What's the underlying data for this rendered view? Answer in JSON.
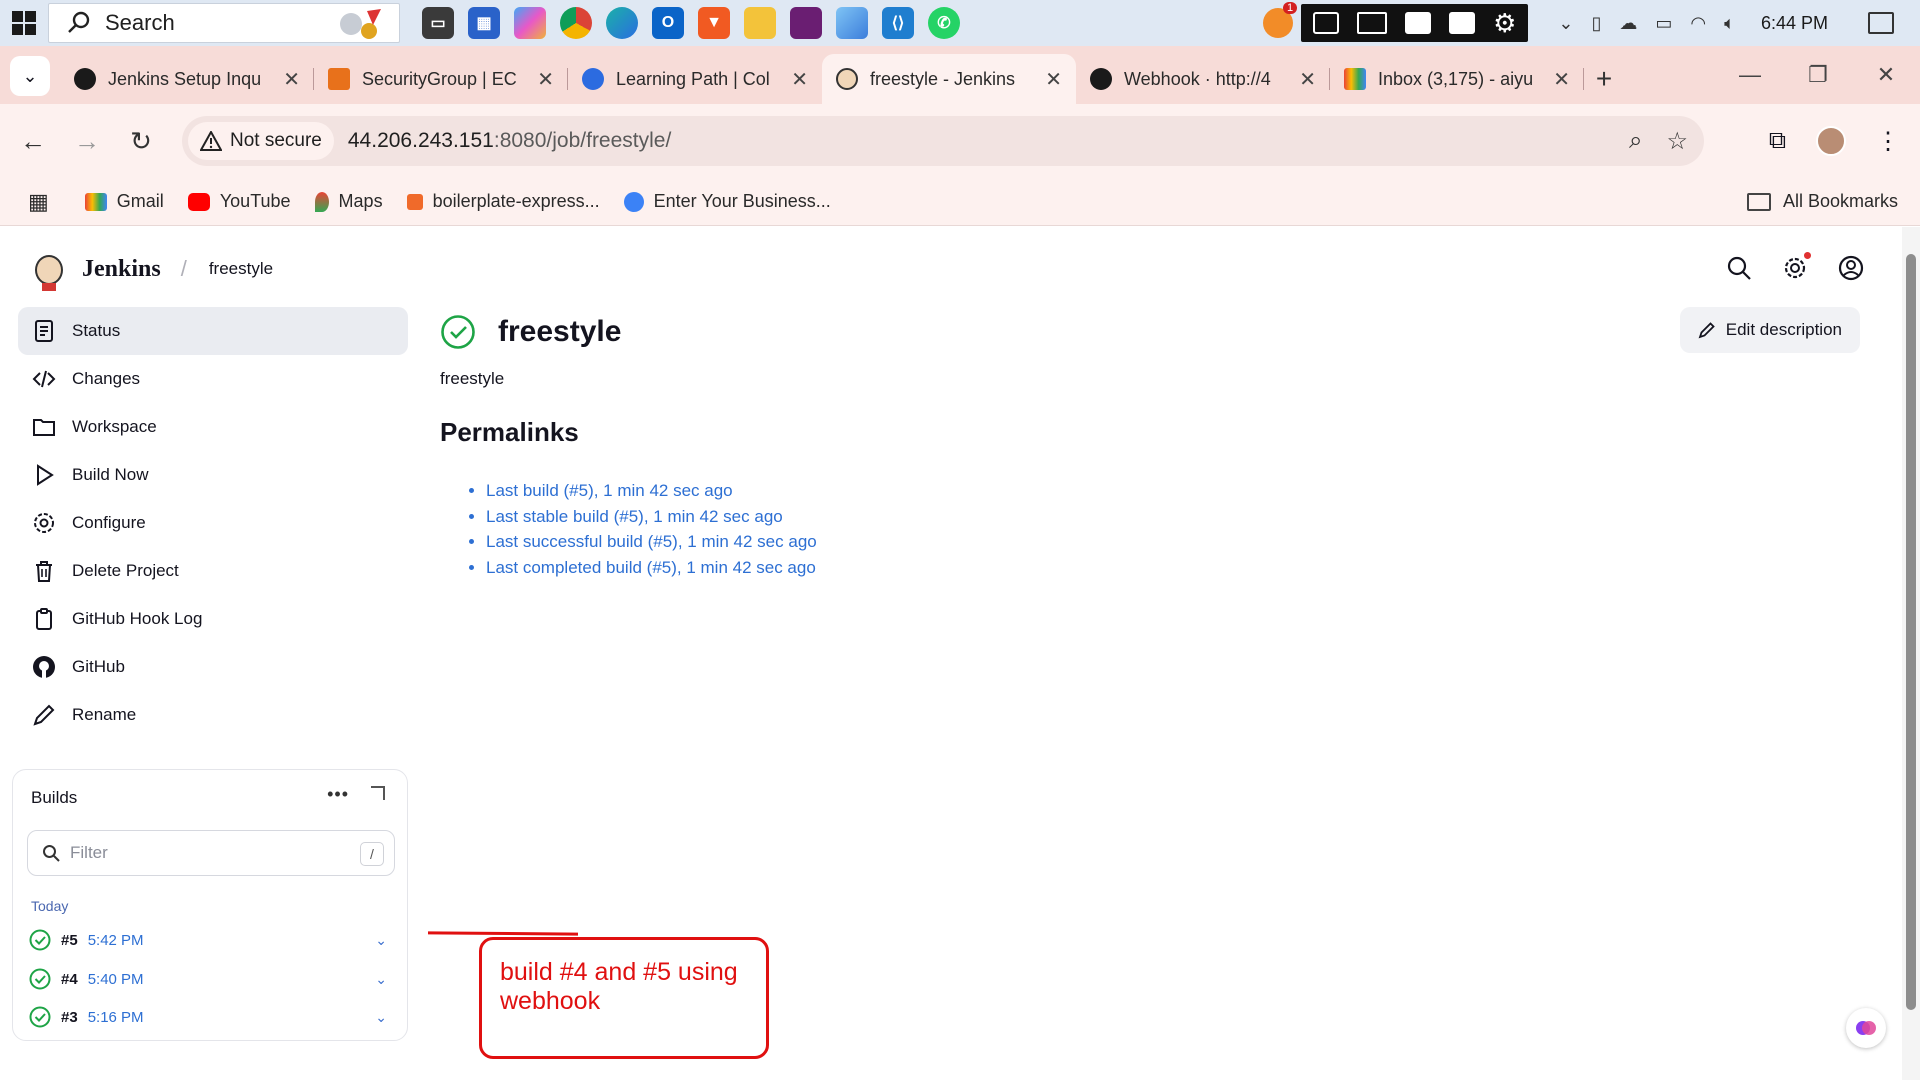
{
  "taskbar": {
    "search_placeholder": "Search",
    "apps": [
      "file-explorer",
      "microsoft-store",
      "copilot",
      "chrome",
      "edge",
      "outlook",
      "brave",
      "file-manager",
      "vscode-remote",
      "power-automate",
      "vscode",
      "whatsapp"
    ],
    "badge_count": "1",
    "clock": "6:44 PM"
  },
  "tabs": [
    {
      "title": "Jenkins Setup Inqu",
      "active": false
    },
    {
      "title": "SecurityGroup | EC",
      "active": false
    },
    {
      "title": "Learning Path | Col",
      "active": false
    },
    {
      "title": "freestyle - Jenkins",
      "active": true
    },
    {
      "title": "Webhook · http://4",
      "active": false
    },
    {
      "title": "Inbox (3,175) - aiyu",
      "active": false
    }
  ],
  "addressbar": {
    "security_label": "Not secure",
    "url_host": "44.206.243.151",
    "url_path": ":8080/job/freestyle/"
  },
  "bookmarks": {
    "items": [
      "Gmail",
      "YouTube",
      "Maps",
      "boilerplate-express...",
      "Enter Your Business..."
    ],
    "all_label": "All Bookmarks"
  },
  "jenkins": {
    "brand": "Jenkins",
    "breadcrumb": "freestyle",
    "sidebar": [
      {
        "label": "Status",
        "icon": "status-icon"
      },
      {
        "label": "Changes",
        "icon": "code-icon"
      },
      {
        "label": "Workspace",
        "icon": "folder-icon"
      },
      {
        "label": "Build Now",
        "icon": "play-icon"
      },
      {
        "label": "Configure",
        "icon": "gear-icon"
      },
      {
        "label": "Delete Project",
        "icon": "trash-icon"
      },
      {
        "label": "GitHub Hook Log",
        "icon": "clipboard-icon"
      },
      {
        "label": "GitHub",
        "icon": "github-icon"
      },
      {
        "label": "Rename",
        "icon": "pencil-icon"
      }
    ],
    "builds": {
      "heading": "Builds",
      "filter_placeholder": "Filter",
      "filter_key": "/",
      "group": "Today",
      "rows": [
        {
          "number": "#5",
          "time": "5:42 PM"
        },
        {
          "number": "#4",
          "time": "5:40 PM"
        },
        {
          "number": "#3",
          "time": "5:16 PM"
        }
      ]
    },
    "job_title": "freestyle",
    "edit_label": "Edit description",
    "description": "freestyle",
    "permalinks_heading": "Permalinks",
    "permalinks": [
      "Last build (#5), 1 min 42 sec ago",
      "Last stable build (#5), 1 min 42 sec ago",
      "Last successful build (#5), 1 min 42 sec ago",
      "Last completed build (#5), 1 min 42 sec ago"
    ]
  },
  "annotation": {
    "text": "build #4 and #5 using webhook"
  },
  "colors": {
    "success": "#1ea446",
    "link": "#2d6fd3",
    "annotation": "#e01010",
    "tabstrip": "#f7dcd8"
  }
}
